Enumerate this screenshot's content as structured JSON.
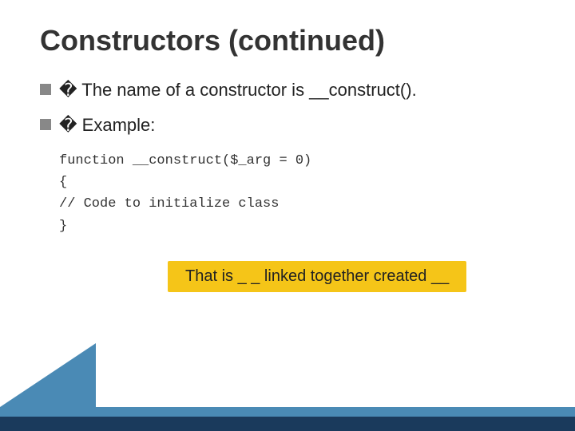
{
  "slide": {
    "title": "Constructors (continued)",
    "bullet1": {
      "prefix": "� The",
      "text": " name of a constructor  is __construct()."
    },
    "bullet2": {
      "prefix": "� Example:",
      "code": [
        "function __construct($_arg = 0)",
        "{",
        "  // Code to initialize class",
        "}"
      ]
    },
    "highlight": {
      "text": "That is _ _ linked together created __"
    }
  }
}
